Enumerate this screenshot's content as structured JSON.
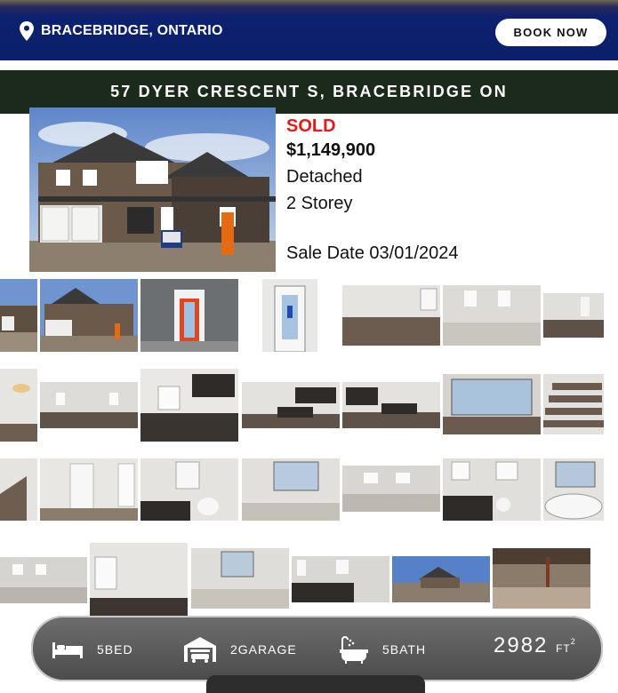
{
  "header": {
    "location": "BRACEBRIDGE, ONTARIO",
    "book_label": "BOOK NOW",
    "icon": "location-pin-icon"
  },
  "listing": {
    "address": "57 DYER CRESCENT S, BRACEBRIDGE ON",
    "status": "SOLD",
    "price": "$1,149,900",
    "type": "Detached",
    "storey": "2 Storey",
    "sale_date": "Sale Date 03/01/2024"
  },
  "stats": {
    "beds": "5BED",
    "garage": "2GARAGE",
    "baths": "5BATH",
    "area_value": "2982",
    "area_unit": "FT",
    "area_sup": "2"
  },
  "colors": {
    "header_bg": "#0b1f6a",
    "address_bar_bg": "#1c2a1c",
    "sold_red": "#e21b1b",
    "stats_bar": "#555555"
  }
}
